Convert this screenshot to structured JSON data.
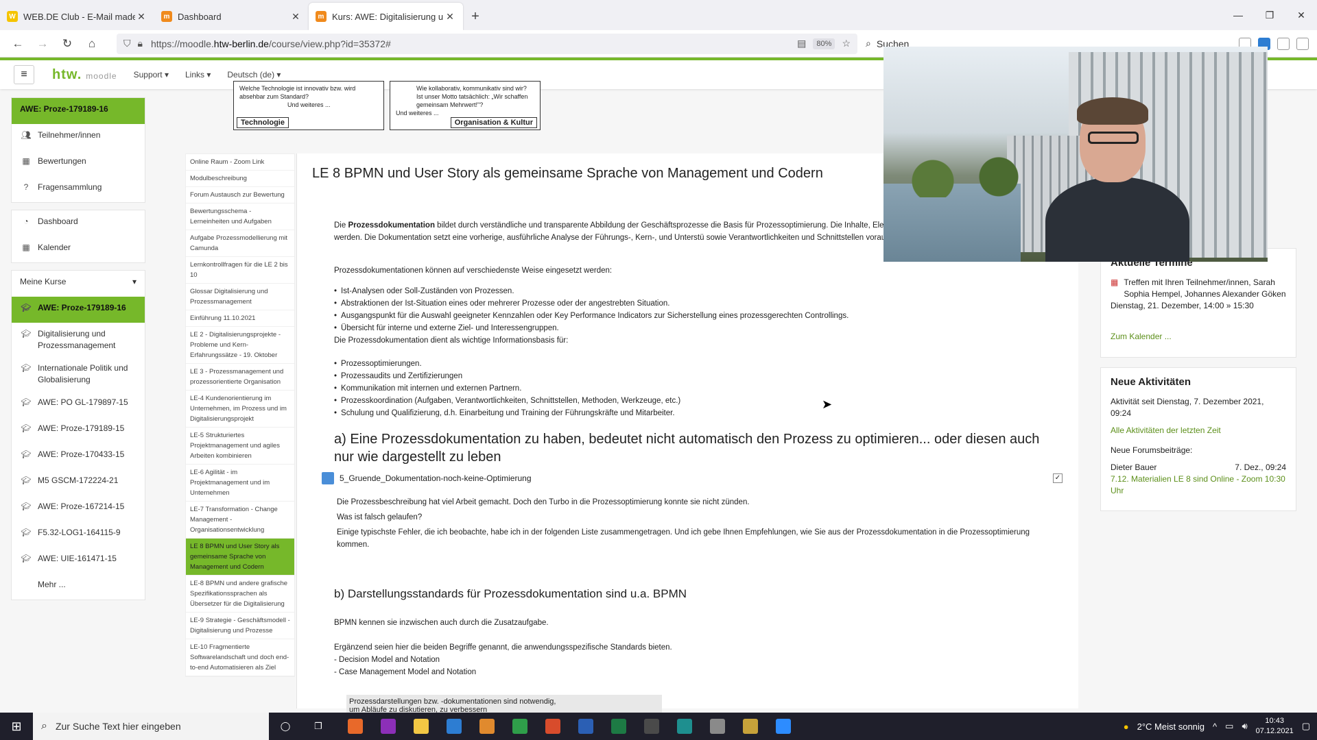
{
  "browser": {
    "tabs": [
      {
        "label": "WEB.DE Club - E-Mail made in",
        "color": "#f5c400"
      },
      {
        "label": "Dashboard",
        "color": "#f08a1c"
      },
      {
        "label": "Kurs: AWE: Digitalisierung und",
        "color": "#f08a1c"
      }
    ],
    "url_prefix": "https://moodle.",
    "url_domain": "htw-berlin.de",
    "url_path": "/course/view.php?id=35372#",
    "zoom": "80%",
    "search_placeholder": "Suchen"
  },
  "moodle": {
    "logo": "htw.",
    "logo_sub": "moodle",
    "menu": [
      "Support",
      "Links",
      "Deutsch (de)"
    ]
  },
  "drawer": {
    "course_short": "AWE: Proze-179189-16",
    "items": [
      "Teilnehmer/innen",
      "Bewertungen",
      "Fragensammlung"
    ],
    "items2": [
      "Dashboard",
      "Kalender"
    ],
    "my_courses_label": "Meine Kurse",
    "courses": [
      "AWE: Proze-179189-16",
      "Digitalisierung und Prozessmanagement",
      "Internationale Politik und Globalisierung",
      "AWE: PO GL-179897-15",
      "AWE: Proze-179189-15",
      "AWE: Proze-170433-15",
      "M5 GSCM-172224-21",
      "AWE: Proze-167214-15",
      "F5.32-LOG1-164115-9",
      "AWE: UIE-161471-15",
      "Mehr ..."
    ]
  },
  "topimages": {
    "left_text": "Welche Technologie ist innovativ bzw. wird absehbar zum Standard?",
    "left_more": "Und weiteres ...",
    "left_label": "Technologie",
    "right_text": "Wie kollaborativ, kommunikativ sind wir? Ist unser Motto tatsächlich: „Wir schaffen gemeinsam Mehrwert!\"?",
    "right_more": "Und weiteres ...",
    "right_label": "Organisation & Kultur"
  },
  "sections": [
    "Online Raum - Zoom Link",
    "Modulbeschreibung",
    "Forum Austausch zur Bewertung",
    "Bewertungsschema - Lerneinheiten und Aufgaben",
    "Aufgabe Prozessmodellierung mit Camunda",
    "Lernkontrollfragen für die LE 2 bis 10",
    "Glossar Digitalisierung und Prozessmanagement",
    "Einführung 11.10.2021",
    "LE 2 - Digitalisierungsprojekte - Probleme und Kern-Erfahrungssätze - 19. Oktober",
    "LE 3 - Prozessmanagement und prozessorientierte Organisation",
    "LE-4 Kundenorientierung im Unternehmen, im Prozess und im Digitalisierungsprojekt",
    "LE-5 Strukturiertes Projektmanagement und agiles Arbeiten kombinieren",
    "LE-6 Agilität - im Projektmanagement und im Unternehmen",
    "LE-7 Transformation - Change Management - Organisationsentwicklung",
    "LE 8 BPMN und User Story als gemeinsame Sprache von Management und Codern",
    "LE-8 BPMN und andere grafische Spezifikationssprachen als Übersetzer für die Digitalisierung",
    "LE-9 Strategie - Geschäftsmodell - Digitalisierung und Prozesse",
    "LE-10 Fragmentierte Softwarelandschaft und doch end-to-end Automatisieren als Ziel"
  ],
  "active_section_index": 14,
  "main": {
    "title": "LE 8 BPMN und User Story als gemeinsame Sprache von Management und Codern",
    "intro_bold": "Prozessdokumentation",
    "intro_pre": "Die ",
    "intro_rest": " bildet durch verständliche und transparente Abbildung der Geschäftsprozesse die Basis für Prozessoptimierung. Die Inhalte, Elementen, müssen kontinuierlich aktualisiert werden. Die Dokumentation setzt eine vorherige, ausführliche Analyse der Führungs-, Kern-, und Unterstü sowie Verantwortlichkeiten und Schnittstellen voraus.",
    "p2": "Prozessdokumentationen können auf verschiedenste Weise eingesetzt werden:",
    "list1": [
      "Ist-Analysen oder Soll-Zuständen von Prozessen.",
      "Abstraktionen der Ist-Situation eines oder mehrerer Prozesse oder der angestrebten Situation.",
      "Ausgangspunkt für die Auswahl geeigneter Kennzahlen oder Key Performance Indicators zur Sicherstellung eines prozessgerechten Controllings.",
      "Übersicht für interne und externe Ziel- und Interessengruppen."
    ],
    "p3": "Die Prozessdokumentation dient als wichtige Informationsbasis für:",
    "list2": [
      "Prozessoptimierungen.",
      "Prozessaudits und Zertifizierungen",
      "Kommunikation mit internen und externen Partnern.",
      "Prozesskoordination (Aufgaben, Verantwortlichkeiten, Schnittstellen, Methoden, Werkzeuge, etc.)",
      "Schulung und Qualifizierung, d.h. Einarbeitung und Training der Führungskräfte und Mitarbeiter."
    ],
    "h2a": "a) Eine Prozessdokumentation zu haben, bedeutet nicht automatisch den Prozess zu optimieren... oder diesen auch nur wie dargestellt zu leben",
    "resource": "5_Gruende_Dokumentation-noch-keine-Optimierung",
    "r1": "Die Prozessbeschreibung hat viel Arbeit gemacht. Doch den Turbo in die Prozessoptimierung konnte sie nicht zünden.",
    "r2": "Was ist falsch gelaufen?",
    "r3": "Einige typischste Fehler, die ich beobachte, habe ich in der folgenden Liste zusammengetragen. Und ich gebe Ihnen Empfehlungen, wie Sie aus der Prozessdokumentation in die Prozessoptimierung kommen.",
    "h2b": "b) Darstellungsstandards für Prozessdokumentation sind u.a. BPMN",
    "b1": "BPMN kennen sie inzwischen auch durch die Zusatzaufgabe.",
    "b2": "Ergänzend seien hier die beiden Begriffe genannt, die anwendungsspezifische Standards bieten.",
    "b3": "- Decision Model and Notation",
    "b4": "- Case Management Model and Notation",
    "caption1": "Prozessdarstellungen bzw. -dokumentationen sind notwendig,",
    "caption2": "um Abläufe zu diskutieren, zu verbessern"
  },
  "right": {
    "events_title": "Aktuelle Termine",
    "event_text": "Treffen mit Ihren Teilnehmer/innen, Sarah Sophia Hempel, Johannes Alexander Göken",
    "event_date": "Dienstag, 21. Dezember, 14:00 » 15:30",
    "calendar_link": "Zum Kalender ...",
    "activity_title": "Neue Aktivitäten",
    "activity_since": "Aktivität seit Dienstag, 7. Dezember 2021, 09:24",
    "activity_all": "Alle Aktivitäten der letzten Zeit",
    "forum_label": "Neue Forumsbeiträge:",
    "forum_author": "Dieter Bauer",
    "forum_date": "7. Dez., 09:24",
    "forum_post": "7.12. Materialien LE 8 sind Online - Zoom 10:30 Uhr"
  },
  "taskbar": {
    "search_placeholder": "Zur Suche Text hier eingeben",
    "weather": "2°C  Meist sonnig",
    "time": "10:43",
    "date": "07.12.2021",
    "apps": [
      "#e8692a",
      "#8c2fb8",
      "#f2c744",
      "#2d7dd2",
      "#e08a2e",
      "#2f9e4a",
      "#d84c2c",
      "#2b5fb4",
      "#1d7a44",
      "#4a4a4a",
      "#1e8f8f",
      "#8a8a8a",
      "#c7a23a",
      "#2d8cff"
    ]
  }
}
